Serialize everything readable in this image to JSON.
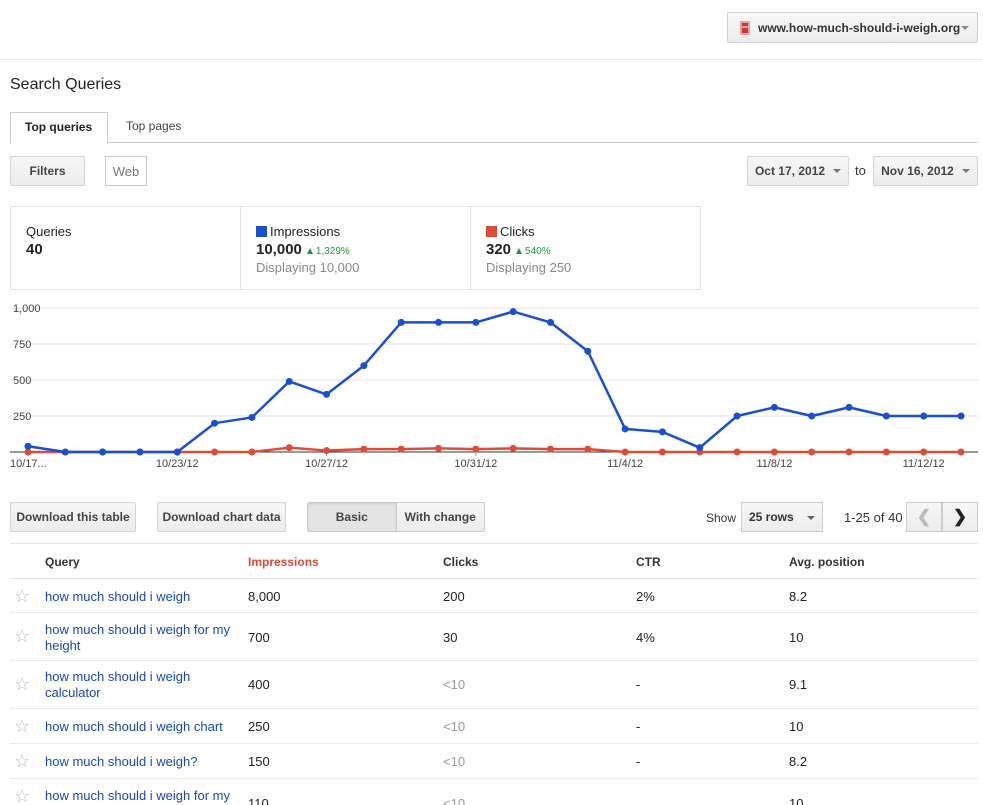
{
  "site_selector": {
    "label": "www.how-much-should-i-weigh.org"
  },
  "page": {
    "title": "Search Queries"
  },
  "tabs": [
    {
      "label": "Top queries"
    },
    {
      "label": "Top pages"
    }
  ],
  "filters": {
    "button_label": "Filters",
    "web_label": "Web"
  },
  "date_range": {
    "start": "Oct 17, 2012",
    "connector": "to",
    "end": "Nov 16, 2012"
  },
  "stats": {
    "queries": {
      "label": "Queries",
      "value": "40"
    },
    "impressions": {
      "label": "Impressions",
      "value": "10,000",
      "change": "1,329%",
      "displaying": "Displaying 10,000",
      "color": "#1a4fd0"
    },
    "clicks": {
      "label": "Clicks",
      "value": "320",
      "change": "540%",
      "displaying": "Displaying 250",
      "color": "#dd4b39"
    }
  },
  "chart_data": {
    "type": "line",
    "y_ticks": [
      "1,000",
      "750",
      "500",
      "250"
    ],
    "ylim": [
      0,
      1000
    ],
    "x_tick_labels": [
      {
        "label": "10/17...",
        "index": 0
      },
      {
        "label": "10/23/12",
        "index": 4
      },
      {
        "label": "10/27/12",
        "index": 8
      },
      {
        "label": "10/31/12",
        "index": 12
      },
      {
        "label": "11/4/12",
        "index": 16
      },
      {
        "label": "11/8/12",
        "index": 20
      },
      {
        "label": "11/12/12",
        "index": 24
      }
    ],
    "series": [
      {
        "name": "Impressions",
        "color": "#1a4fd0",
        "values": [
          40,
          0,
          0,
          0,
          0,
          200,
          240,
          490,
          400,
          600,
          900,
          900,
          900,
          975,
          900,
          700,
          160,
          140,
          30,
          250,
          310,
          250,
          310,
          250,
          250,
          250
        ]
      },
      {
        "name": "Clicks",
        "color": "#dd4b39",
        "values": [
          0,
          0,
          0,
          0,
          0,
          0,
          0,
          30,
          10,
          20,
          20,
          25,
          20,
          25,
          20,
          20,
          0,
          0,
          0,
          0,
          0,
          0,
          0,
          0,
          0,
          0
        ]
      }
    ]
  },
  "toolbar": {
    "download_table": "Download this table",
    "download_chart": "Download chart data",
    "basic": "Basic",
    "with_change": "With change",
    "show_label": "Show",
    "rows_value": "25 rows",
    "page_range": "1-25 of 40",
    "prev": "❮",
    "next": "❯"
  },
  "table": {
    "headers": {
      "query": "Query",
      "impressions": "Impressions",
      "clicks": "Clicks",
      "ctr": "CTR",
      "position": "Avg. position"
    },
    "rows": [
      {
        "query": "how much should i weigh",
        "impressions": "8,000",
        "clicks": "200",
        "ctr": "2%",
        "position": "8.2"
      },
      {
        "query": "how much should i weigh for my height",
        "impressions": "700",
        "clicks": "30",
        "ctr": "4%",
        "position": "10"
      },
      {
        "query": "how much should i weigh calculator",
        "impressions": "400",
        "clicks": "<10",
        "ctr": "-",
        "position": "9.1"
      },
      {
        "query": "how much should i weigh chart",
        "impressions": "250",
        "clicks": "<10",
        "ctr": "-",
        "position": "10"
      },
      {
        "query": "how much should i weigh?",
        "impressions": "150",
        "clicks": "<10",
        "ctr": "-",
        "position": "8.2"
      },
      {
        "query": "how much should i weigh for my",
        "impressions": "110",
        "clicks": "<10",
        "ctr": "",
        "position": "10"
      }
    ]
  }
}
